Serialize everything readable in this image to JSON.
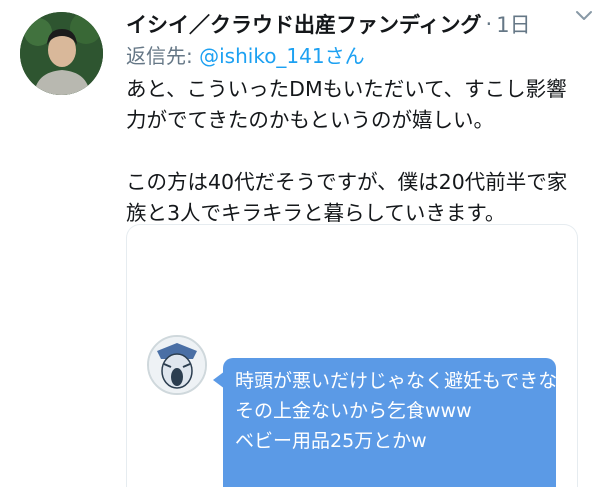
{
  "tweet": {
    "display_name": "イシイ／クラウド出産ファンディング",
    "separator": "·",
    "time": "1日",
    "reply_prefix": "返信先: ",
    "reply_handle": "@ishiko_141さん",
    "text": "あと、こういったDMもいただいて、すこし影響力がでてきたのかもというのが嬉しい。\n\nこの方は40代だそうですが、僕は20代前半で家族と3人でキラキラと暮らしていきます。"
  },
  "dm_card": {
    "lines": [
      "時頭が悪いだけじゃなく避妊もできない猿🐒www",
      "その上金ないから乞食www",
      "ベビー用品25万とかw"
    ],
    "bubble_color": "#5b9ae6"
  },
  "icons": {
    "chevron": "chevron-down-icon"
  },
  "colors": {
    "link": "#1da1f2",
    "muted": "#657786"
  }
}
